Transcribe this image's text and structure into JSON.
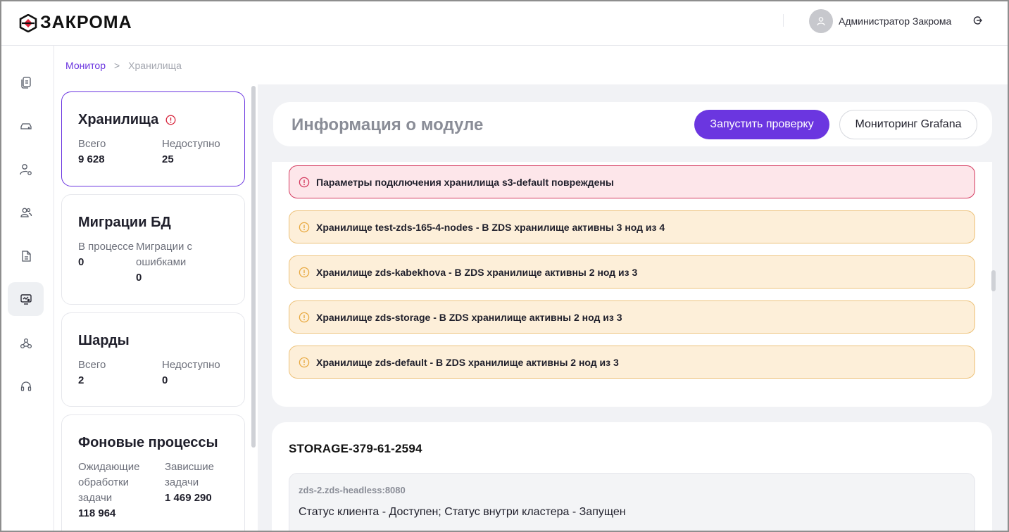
{
  "header": {
    "logo_text": "ЗАКРОМА",
    "user_name": "Администратор Закрома"
  },
  "breadcrumb": {
    "parent": "Монитор",
    "separator": ">",
    "current": "Хранилища"
  },
  "cards": [
    {
      "title": "Хранилища",
      "has_warning": true,
      "stats": [
        {
          "label": "Всего",
          "value": "9 628"
        },
        {
          "label": "Недоступно",
          "value": "25"
        }
      ]
    },
    {
      "title": "Миграции БД",
      "stats": [
        {
          "label": "В процессе",
          "value": "0"
        },
        {
          "label": "Миграции с ошибками",
          "value": "0"
        }
      ]
    },
    {
      "title": "Шарды",
      "stats": [
        {
          "label": "Всего",
          "value": "2"
        },
        {
          "label": "Недоступно",
          "value": "0"
        }
      ]
    },
    {
      "title": "Фоновые процессы",
      "stats": [
        {
          "label": "Ожидающие обработки задачи",
          "value": "118 964"
        },
        {
          "label": "Зависшие задачи",
          "value": "1 469 290"
        }
      ]
    }
  ],
  "module": {
    "title": "Информация о модуле",
    "run_check_label": "Запустить проверку",
    "grafana_label": "Мониторинг Grafana"
  },
  "alerts": [
    {
      "level": "error",
      "text": "Параметры подключения хранилища s3-default повреждены"
    },
    {
      "level": "warn",
      "text": "Хранилище test-zds-165-4-nodes - В ZDS хранилище активны 3 нод из 4"
    },
    {
      "level": "warn",
      "text": "Хранилище zds-kabekhova - В ZDS хранилище активны 2 нод из 3"
    },
    {
      "level": "warn",
      "text": "Хранилище zds-storage - В ZDS хранилище активны 2 нод из 3"
    },
    {
      "level": "warn",
      "text": "Хранилище zds-default - В ZDS хранилище активны 2 нод из 3"
    }
  ],
  "storage": {
    "id": "STORAGE-379-61-2594",
    "node_host": "zds-2.zds-headless:8080",
    "node_status": "Статус клиента - Доступен; Статус внутри кластера - Запущен"
  },
  "colors": {
    "accent": "#6b36e0",
    "error": "#d43a5f",
    "warn": "#edc27a"
  },
  "nav_icons": [
    "documents-icon",
    "storage-drive-icon",
    "user-settings-icon",
    "users-icon",
    "file-icon",
    "monitor-icon",
    "network-icon",
    "headset-icon"
  ]
}
